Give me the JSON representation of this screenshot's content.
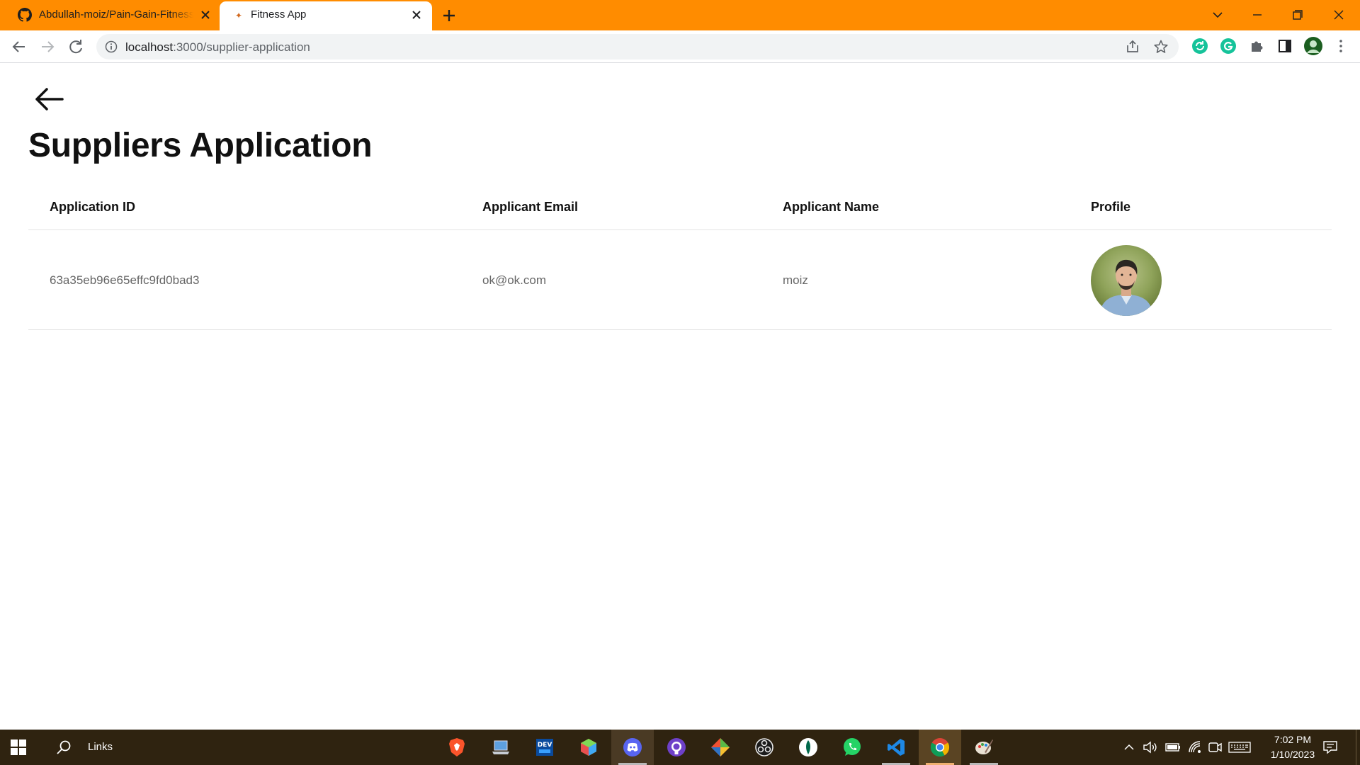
{
  "browser": {
    "tabs": [
      {
        "title": "Abdullah-moiz/Pain-Gain-Fitness",
        "favicon": "github-icon"
      },
      {
        "title": "Fitness App",
        "favicon": "fitness-app-icon",
        "active": true
      }
    ],
    "url_host": "localhost",
    "url_path": ":3000/supplier-application",
    "tabstrip_color": "#ff8c00"
  },
  "page": {
    "title": "Suppliers Application",
    "table": {
      "headers": {
        "id": "Application ID",
        "email": "Applicant Email",
        "name": "Applicant Name",
        "profile": "Profile"
      },
      "rows": [
        {
          "id": "63a35eb96e65effc9fd0bad3",
          "email": "ok@ok.com",
          "name": "moiz",
          "profile": "profile-photo"
        }
      ]
    }
  },
  "taskbar": {
    "search_label": "Links",
    "apps": [
      "brave-icon",
      "laptop-icon",
      "dev-icon",
      "app-cube-icon",
      "discord-icon",
      "github-desktop-icon",
      "git-icon",
      "obs-icon",
      "mongodb-compass-icon",
      "whatsapp-icon",
      "vscode-icon",
      "chrome-icon",
      "paint-icon"
    ],
    "time": "7:02 PM",
    "date": "1/10/2023"
  }
}
